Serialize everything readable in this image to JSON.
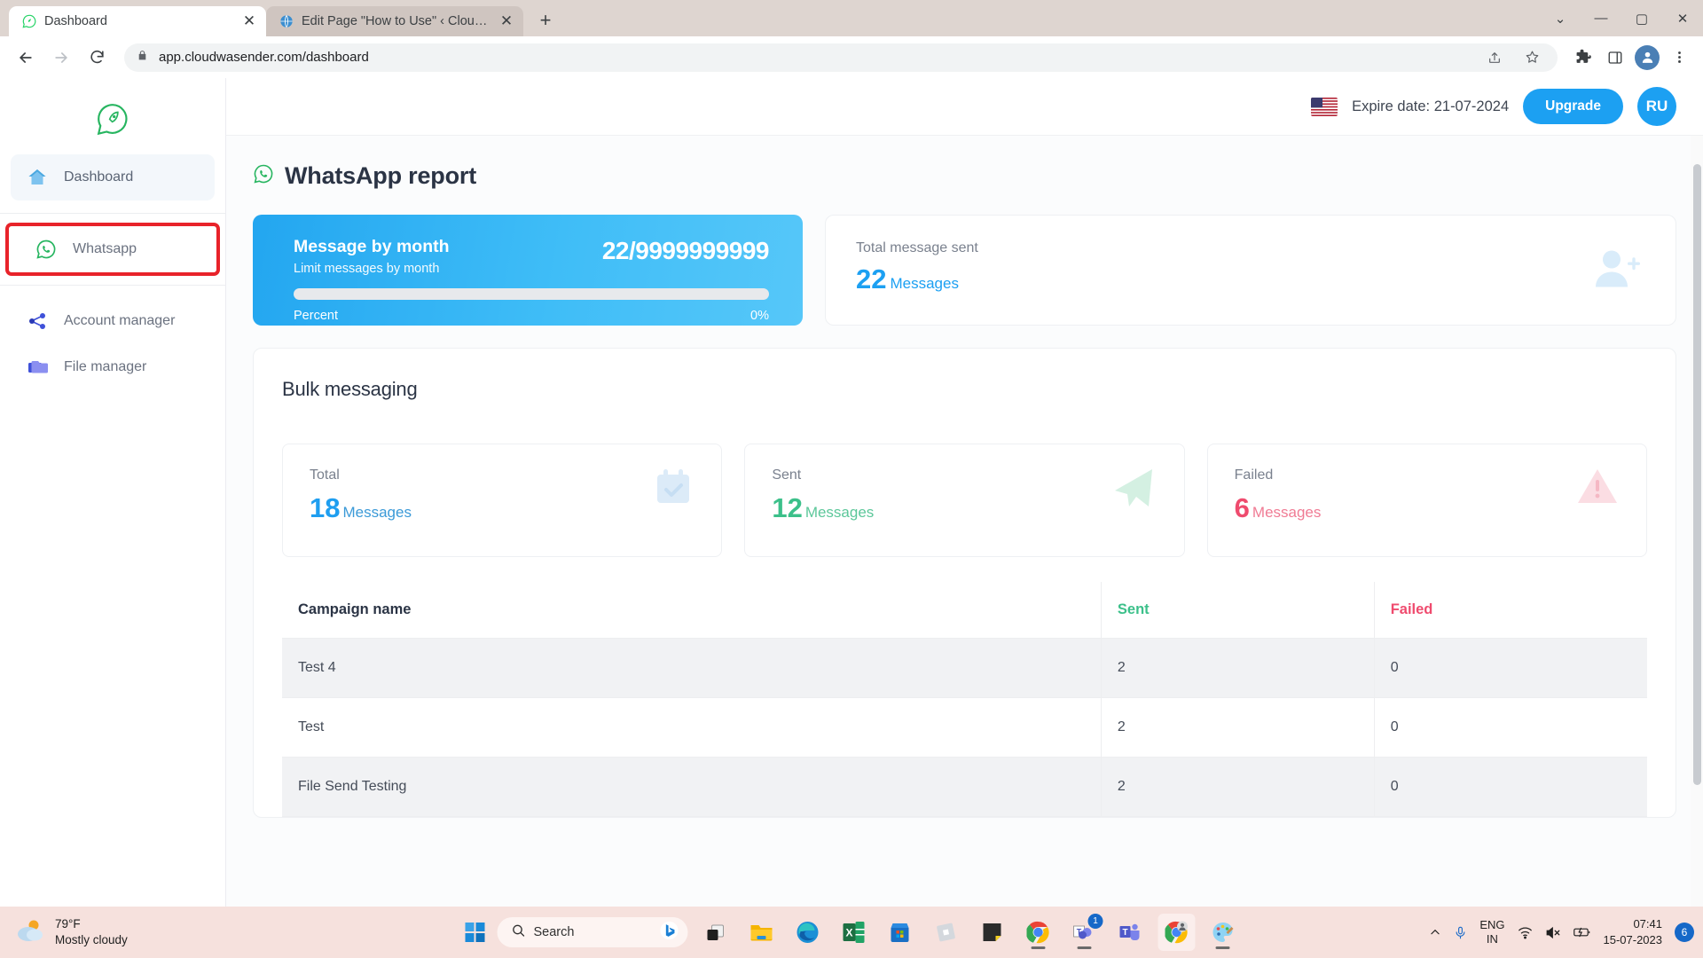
{
  "browser": {
    "tabs": [
      {
        "title": "Dashboard",
        "favicon": "whatsapp-rocket-icon",
        "active": true
      },
      {
        "title": "Edit Page \"How to Use\" ‹ Cloud W",
        "favicon": "globe-icon",
        "active": false
      }
    ],
    "new_tab_label": "+",
    "window_controls": {
      "minimize_all": "⌄",
      "minimize": "—",
      "maximize": "▢",
      "close": "✕"
    },
    "address": "app.cloudwasender.com/dashboard",
    "lock_icon": "lock-icon",
    "nav": {
      "back": "←",
      "forward": "→",
      "reload": "⟳"
    },
    "toolbar_icons": [
      "share-icon",
      "bookmark-star-icon",
      "extensions-puzzle-icon",
      "side-panel-icon",
      "profile-avatar-icon",
      "more-menu-icon"
    ]
  },
  "sidebar": {
    "logo": "whatsapp-rocket-logo",
    "items": [
      {
        "label": "Dashboard",
        "icon": "home-icon",
        "active": true,
        "highlighted": false
      },
      {
        "label": "Whatsapp",
        "icon": "whatsapp-icon",
        "active": false,
        "highlighted": true
      },
      {
        "label": "Account manager",
        "icon": "share-nodes-icon",
        "active": false,
        "highlighted": false
      },
      {
        "label": "File manager",
        "icon": "folder-icon",
        "active": false,
        "highlighted": false
      }
    ]
  },
  "topbar": {
    "flag": "us-flag-icon",
    "expire_text": "Expire date: 21-07-2024",
    "upgrade_label": "Upgrade",
    "user_initials": "RU"
  },
  "page": {
    "title": "WhatsApp report",
    "title_icon": "whatsapp-icon"
  },
  "message_card": {
    "title": "Message by month",
    "subtitle": "Limit messages by month",
    "counter": "22/9999999999",
    "progress_label": "Percent",
    "progress_value": "0%",
    "progress_percent": 0
  },
  "total_sent_card": {
    "label": "Total message sent",
    "value": "22",
    "unit": "Messages",
    "icon": "user-plus-icon",
    "color": "#1ca0f2"
  },
  "bulk": {
    "title": "Bulk messaging",
    "stats": [
      {
        "label": "Total",
        "value": "18",
        "unit": "Messages",
        "color": "#1e9ef0",
        "icon": "calendar-check-icon"
      },
      {
        "label": "Sent",
        "value": "12",
        "unit": "Messages",
        "color": "#3cc08a",
        "icon": "paper-plane-icon"
      },
      {
        "label": "Failed",
        "value": "6",
        "unit": "Messages",
        "color": "#ef4b6e",
        "icon": "warning-triangle-icon"
      }
    ],
    "table": {
      "columns": [
        "Campaign name",
        "Sent",
        "Failed"
      ],
      "rows": [
        {
          "name": "Test 4",
          "sent": "2",
          "failed": "0"
        },
        {
          "name": "Test",
          "sent": "2",
          "failed": "0"
        },
        {
          "name": "File Send Testing",
          "sent": "2",
          "failed": "0"
        }
      ]
    }
  },
  "taskbar": {
    "weather": {
      "temp": "79°F",
      "condition": "Mostly cloudy",
      "icon": "partly-cloudy-icon"
    },
    "start_icon": "windows-start-icon",
    "search_placeholder": "Search",
    "search_icon": "search-icon",
    "bing_icon": "bing-chat-icon",
    "apps": [
      {
        "name": "task-view-icon"
      },
      {
        "name": "file-explorer-icon"
      },
      {
        "name": "microsoft-edge-icon"
      },
      {
        "name": "excel-icon"
      },
      {
        "name": "microsoft-store-icon"
      },
      {
        "name": "roblox-icon"
      },
      {
        "name": "sticky-notes-icon"
      },
      {
        "name": "google-chrome-icon"
      },
      {
        "name": "teams-chat-icon",
        "badge": "1"
      },
      {
        "name": "microsoft-teams-icon"
      },
      {
        "name": "chrome-profile-icon",
        "focused": true
      },
      {
        "name": "paint-icon"
      }
    ],
    "tray": {
      "chevron": "show-hidden-icons-icon",
      "mic": "microphone-icon",
      "language": "ENG",
      "region": "IN",
      "wifi": "wifi-icon",
      "volume": "volume-muted-icon",
      "battery": "battery-charging-icon",
      "time": "07:41",
      "date": "15-07-2023",
      "notification_count": "6"
    }
  }
}
